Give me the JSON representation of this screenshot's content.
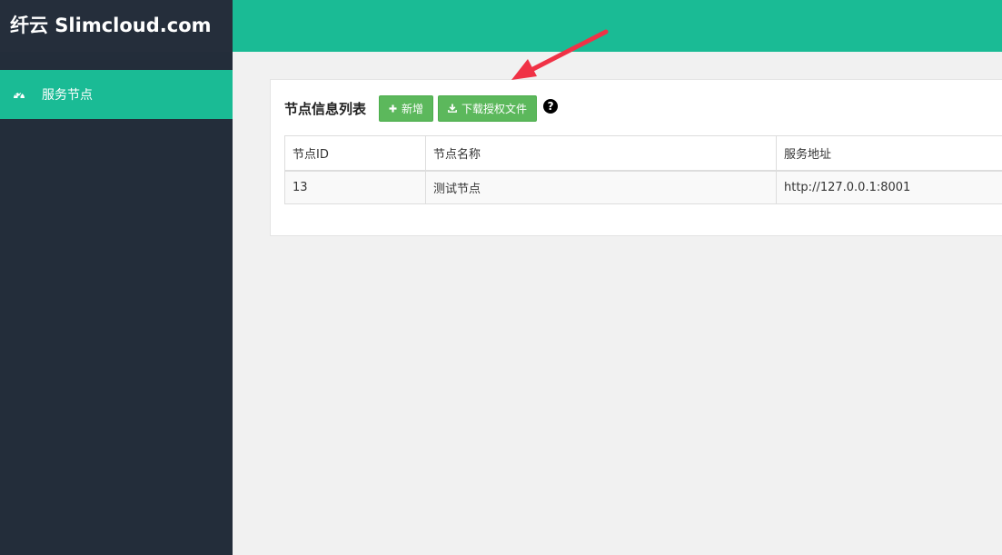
{
  "sidebar": {
    "brand": "纤云 Slimcloud.com",
    "items": [
      {
        "label": "服务节点",
        "icon": "dashboard-icon",
        "active": true
      }
    ]
  },
  "panel": {
    "title": "节点信息列表",
    "add_button": "新增",
    "download_button": "下载授权文件",
    "help_icon": "question-circle-icon"
  },
  "table": {
    "columns": [
      "节点ID",
      "节点名称",
      "服务地址"
    ],
    "rows": [
      [
        "13",
        "测试节点",
        "http://127.0.0.1:8001"
      ]
    ]
  },
  "colors": {
    "accent": "#1abb95",
    "sidebar_bg": "#232d3a",
    "button_green": "#5cb85c",
    "annotation_arrow": "#f03246"
  }
}
